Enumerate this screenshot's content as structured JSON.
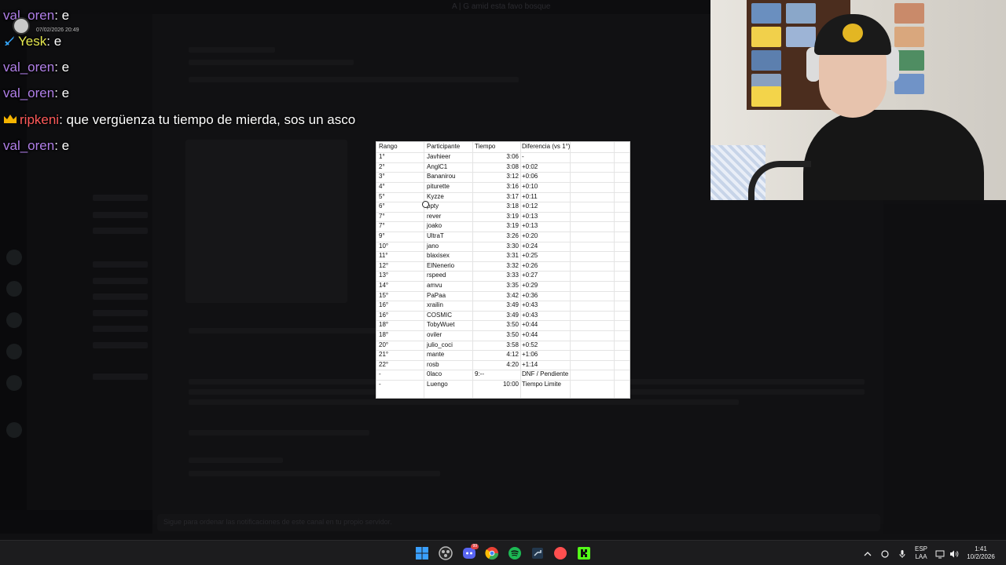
{
  "background_app": {
    "window_title": "A | G amid esta favo bosque",
    "input_placeholder": "Sigue para ordenar las notificaciones de este canal en tu propio servidor."
  },
  "stream_chat": {
    "notification_date": "07/02/2026 20:49",
    "messages": [
      {
        "user": "val_oren",
        "separator": ":",
        "text": " e"
      },
      {
        "user": "Yesk",
        "separator": ":",
        "text": " e",
        "badge": "sword-badge"
      },
      {
        "user": "val_oren",
        "separator": ":",
        "text": " e"
      },
      {
        "user": "val_oren",
        "separator": ":",
        "text": " e"
      },
      {
        "user": "ripkeni",
        "separator": ":",
        "text": " que vergüenza tu tiempo de mierda, sos un asco",
        "badge": "crown-badge"
      },
      {
        "user": "val_oren",
        "separator": ":",
        "text": " e"
      }
    ]
  },
  "results_table": {
    "headers": {
      "rank": "Rango",
      "player": "Participante",
      "time": "Tiempo",
      "diff": "Diferencia (vs 1°)"
    },
    "rows": [
      {
        "rank": "1°",
        "player": "Javhieer",
        "time": "3:06",
        "diff": "-"
      },
      {
        "rank": "2°",
        "player": "AnglC1",
        "time": "3:08",
        "diff": "+0:02"
      },
      {
        "rank": "3°",
        "player": "Bananirou",
        "time": "3:12",
        "diff": "+0:06"
      },
      {
        "rank": "4°",
        "player": "piturette",
        "time": "3:16",
        "diff": "+0:10"
      },
      {
        "rank": "5°",
        "player": "Kyzze",
        "time": "3:17",
        "diff": "+0:11"
      },
      {
        "rank": "6°",
        "player": "ppty",
        "time": "3:18",
        "diff": "+0:12"
      },
      {
        "rank": "7°",
        "player": "rever",
        "time": "3:19",
        "diff": "+0:13"
      },
      {
        "rank": "7°",
        "player": "joako",
        "time": "3:19",
        "diff": "+0:13"
      },
      {
        "rank": "9°",
        "player": "UltraT",
        "time": "3:26",
        "diff": "+0:20"
      },
      {
        "rank": "10°",
        "player": "jano",
        "time": "3:30",
        "diff": "+0:24"
      },
      {
        "rank": "11°",
        "player": "blaxisex",
        "time": "3:31",
        "diff": "+0:25"
      },
      {
        "rank": "12°",
        "player": "ElNenerio",
        "time": "3:32",
        "diff": "+0:26"
      },
      {
        "rank": "13°",
        "player": "rspeed",
        "time": "3:33",
        "diff": "+0:27"
      },
      {
        "rank": "14°",
        "player": "amvu",
        "time": "3:35",
        "diff": "+0:29"
      },
      {
        "rank": "15°",
        "player": "PaPaa",
        "time": "3:42",
        "diff": "+0:36"
      },
      {
        "rank": "16°",
        "player": "xrailin",
        "time": "3:49",
        "diff": "+0:43"
      },
      {
        "rank": "16°",
        "player": "COSMIC",
        "time": "3:49",
        "diff": "+0:43"
      },
      {
        "rank": "18°",
        "player": "TobyWuet",
        "time": "3:50",
        "diff": "+0:44"
      },
      {
        "rank": "18°",
        "player": "oviler",
        "time": "3:50",
        "diff": "+0:44"
      },
      {
        "rank": "20°",
        "player": "julio_coci",
        "time": "3:58",
        "diff": "+0:52"
      },
      {
        "rank": "21°",
        "player": "mante",
        "time": "4:12",
        "diff": "+1:06"
      },
      {
        "rank": "22°",
        "player": "rosb",
        "time": "4:20",
        "diff": "+1:14"
      },
      {
        "rank": "-",
        "player": "0laco",
        "time": "9:--",
        "diff": "DNF / Pendiente",
        "time_align": "left"
      },
      {
        "rank": "-",
        "player": "Luengo",
        "time": "10:00",
        "diff": "Tiempo Limite"
      }
    ]
  },
  "taskbar": {
    "apps": [
      {
        "name": "start-icon",
        "color": "#3aa0ff"
      },
      {
        "name": "obs-icon",
        "color": "#bbbbbb"
      },
      {
        "name": "discord-icon",
        "color": "#5865f2",
        "badge": "99"
      },
      {
        "name": "chrome-icon",
        "color": "#e94235"
      },
      {
        "name": "spotify-icon",
        "color": "#1db954"
      },
      {
        "name": "steam-icon",
        "color": "#c7d5e0"
      },
      {
        "name": "browser-icon",
        "color": "#ff4f4f"
      },
      {
        "name": "kick-icon",
        "color": "#53fc18"
      }
    ],
    "language": "ESP",
    "layout": "LAA",
    "clock_time": "1:41",
    "clock_date": "10/2/2026"
  }
}
